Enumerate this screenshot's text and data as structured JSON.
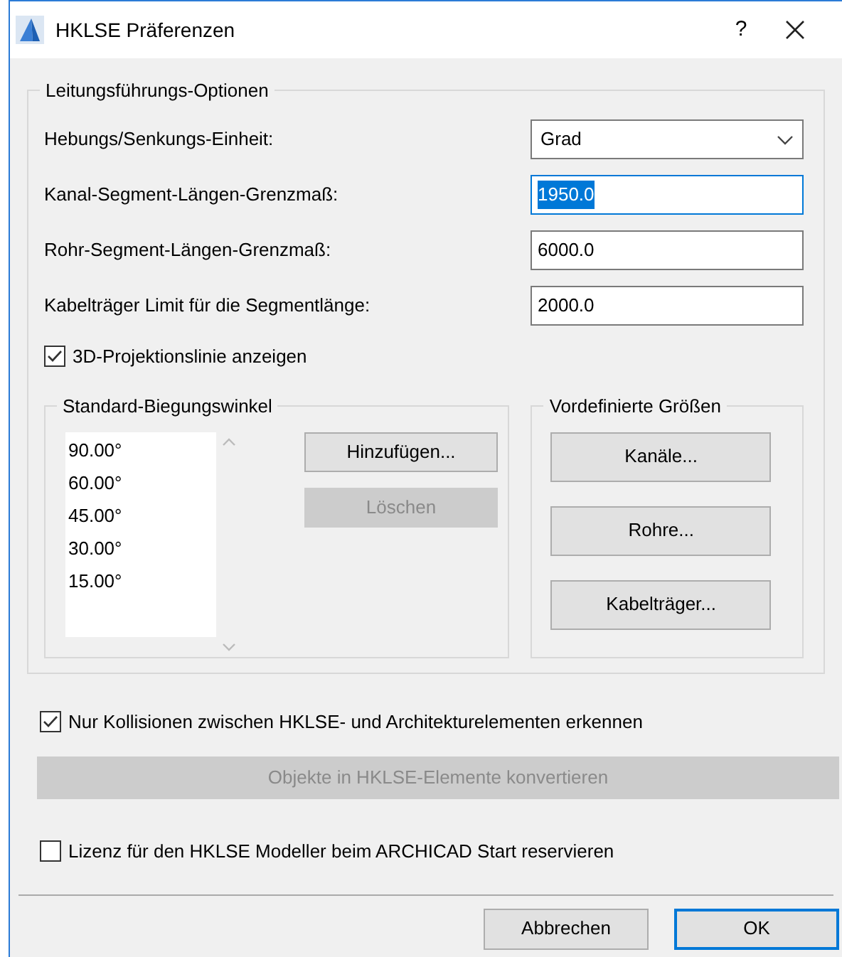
{
  "window": {
    "title": "HKLSE Präferenzen",
    "help": "?"
  },
  "routing_group": {
    "title": "Leitungsführungs-Optionen",
    "fields": [
      {
        "label": "Hebungs/Senkungs-Einheit:",
        "kind": "select",
        "value": "Grad"
      },
      {
        "label": "Kanal-Segment-Längen-Grenzmaß:",
        "kind": "text",
        "value": "1950.0",
        "focused": true
      },
      {
        "label": "Rohr-Segment-Längen-Grenzmaß:",
        "kind": "text",
        "value": "6000.0",
        "focused": false
      },
      {
        "label": "Kabelträger Limit für die Segmentlänge:",
        "kind": "text",
        "value": "2000.0",
        "focused": false
      }
    ],
    "projection_checkbox": {
      "label": "3D-Projektionslinie anzeigen",
      "checked": true
    },
    "bend_angles": {
      "title": "Standard-Biegungswinkel",
      "items": [
        "90.00°",
        "60.00°",
        "45.00°",
        "30.00°",
        "15.00°"
      ],
      "buttons": [
        {
          "label": "Hinzufügen...",
          "disabled": false
        },
        {
          "label": "Löschen",
          "disabled": true
        }
      ]
    },
    "predefined_sizes": {
      "title": "Vordefinierte Größen",
      "buttons": [
        {
          "label": "Kanäle...",
          "disabled": false
        },
        {
          "label": "Rohre...",
          "disabled": false
        },
        {
          "label": "Kabelträger...",
          "disabled": false
        }
      ]
    }
  },
  "collision_checkbox": {
    "label": "Nur Kollisionen zwischen HKLSE- und Architekturelementen erkennen",
    "checked": true
  },
  "convert_button": {
    "label": "Objekte in HKLSE-Elemente konvertieren",
    "disabled": true
  },
  "license_checkbox": {
    "label": "Lizenz für den HKLSE Modeller beim ARCHICAD Start reservieren",
    "checked": false
  },
  "footer_buttons": [
    {
      "label": "Abbrechen",
      "default": false
    },
    {
      "label": "OK",
      "default": true
    }
  ]
}
